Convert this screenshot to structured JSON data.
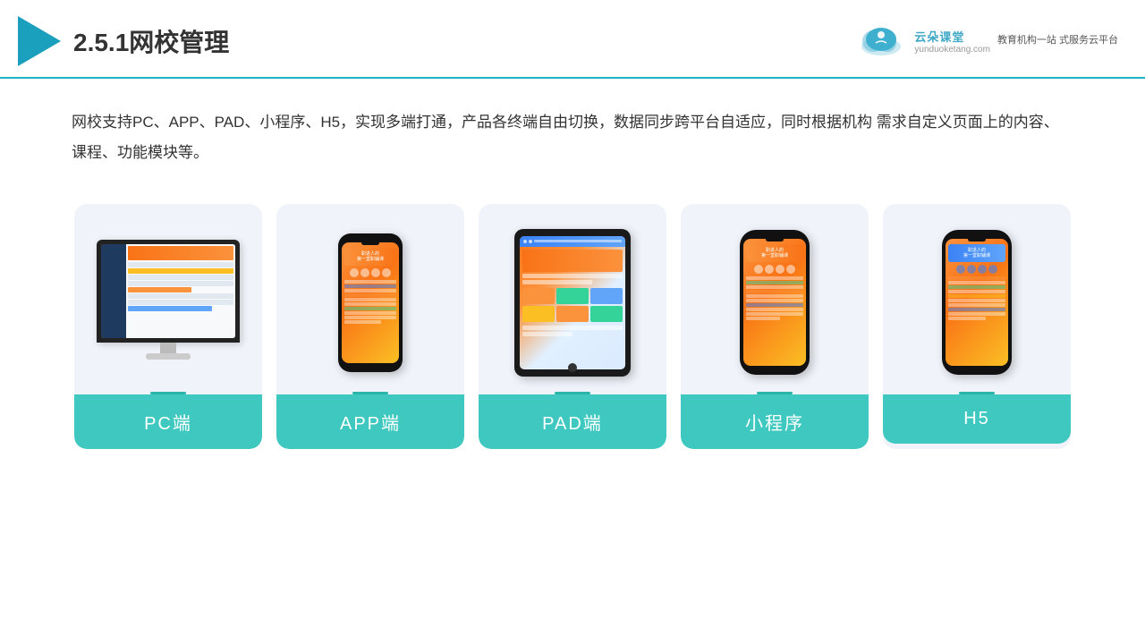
{
  "header": {
    "title": "2.5.1网校管理",
    "brand_name": "云朵课堂",
    "brand_url": "yunduoketang.com",
    "brand_slogan": "教育机构一站\n式服务云平台"
  },
  "description": "网校支持PC、APP、PAD、小程序、H5，实现多端打通，产品各终端自由切换，数据同步跨平台自适应，同时根据机构\n需求自定义页面上的内容、课程、功能模块等。",
  "cards": [
    {
      "id": "pc",
      "label": "PC端"
    },
    {
      "id": "app",
      "label": "APP端"
    },
    {
      "id": "pad",
      "label": "PAD端"
    },
    {
      "id": "miniprogram",
      "label": "小程序"
    },
    {
      "id": "h5",
      "label": "H5"
    }
  ],
  "colors": {
    "accent": "#3ec8c0",
    "header_line": "#1ab3c8",
    "logo_triangle": "#1a9fbd",
    "card_bg": "#f0f4fa",
    "card_label_bg": "#3ec8c0"
  }
}
